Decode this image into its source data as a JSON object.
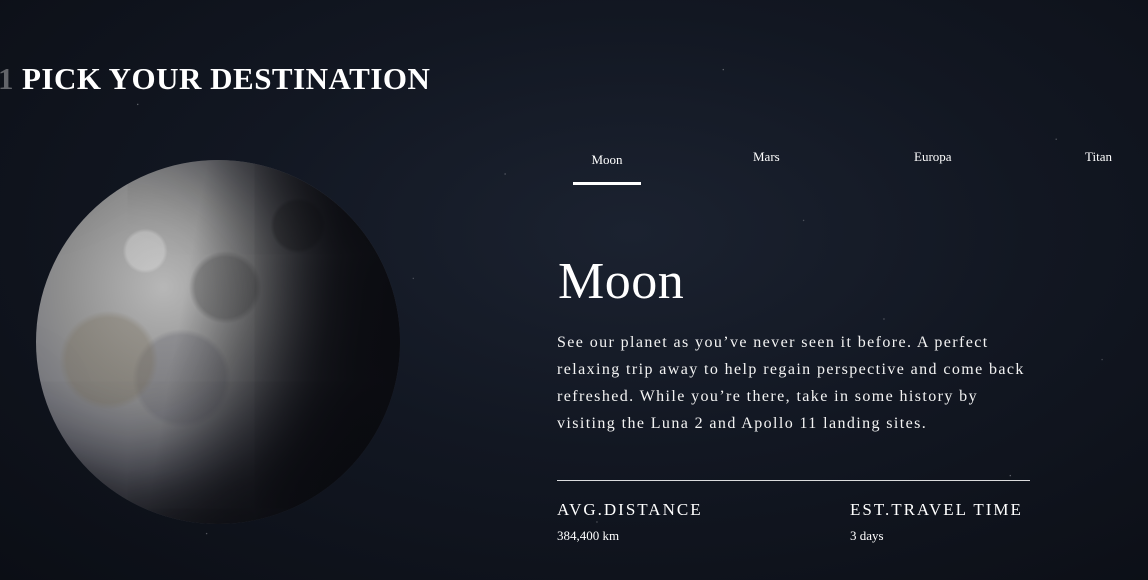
{
  "header": {
    "step_number": "1",
    "title": "PICK YOUR DESTINATION"
  },
  "image": {
    "alt": "Moon"
  },
  "tabs": [
    {
      "label": "Moon",
      "active": true
    },
    {
      "label": "Mars",
      "active": false
    },
    {
      "label": "Europa",
      "active": false
    },
    {
      "label": "Titan",
      "active": false
    }
  ],
  "destination": {
    "name": "Moon",
    "description": "See our planet as you’ve never seen it before. A perfect relaxing trip away to help regain perspective and come back refreshed. While you’re there, take in some history by visiting the Luna 2 and Apollo 11 landing sites."
  },
  "stats": {
    "distance_label": "AVG.DISTANCE",
    "distance_value": "384,400 km",
    "time_label": "EST.TRAVEL TIME",
    "time_value": "3 days"
  },
  "colors": {
    "background": "#0b0e15",
    "text": "#ffffff",
    "muted": "#5a5d66"
  }
}
